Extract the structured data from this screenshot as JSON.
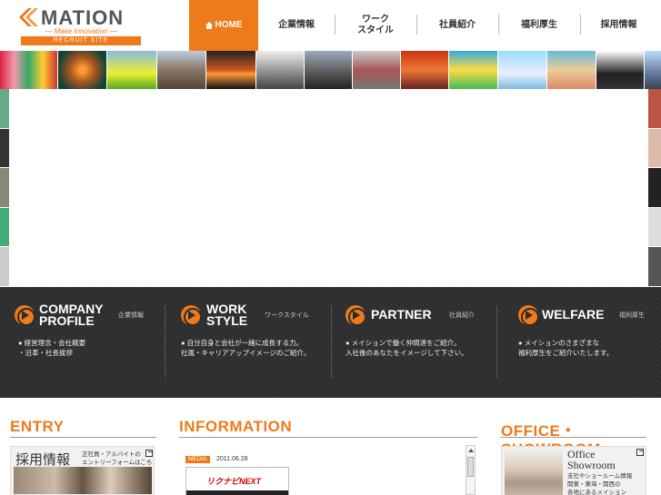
{
  "header": {
    "logo_word": "MATION",
    "logo_tagline": "― Make Innovation ―",
    "logo_site": "RECRUIT SITE",
    "brand_color": "#ef7a1a"
  },
  "nav": {
    "home": "HOME",
    "company": "企業情報",
    "workstyle": "ワーク\nスタイル",
    "staff": "社員紹介",
    "welfare": "福利厚生",
    "recruit": "採用情報"
  },
  "sections": {
    "company": {
      "title": "COMPANY\nPROFILE",
      "jp": "企業情報",
      "desc": "● 経営理念・会社概要\n・沿革・社長挨拶"
    },
    "work": {
      "title": "WORK\nSTYLE",
      "jp": "ワークスタイル",
      "desc": "● 自分自身と会社が一緒に成長する力。\n社風・キャリアアップイメージのご紹介。"
    },
    "partner": {
      "title": "PARTNER",
      "jp": "社員紹介",
      "desc": "● メイションで働く仲間達をご紹介。\n入社後のあなたをイメージして下さい。"
    },
    "welfare": {
      "title": "WELFARE",
      "jp": "福利厚生",
      "desc": "● メイションのさまざまな\n福利厚生をご紹介いたします。"
    }
  },
  "entry": {
    "heading": "ENTRY",
    "card_title": "採用情報",
    "card_text": "正社員・アルバイトの\nエントリーフォームはこちら"
  },
  "information": {
    "heading": "INFORMATION",
    "tag": "MEDIA",
    "date": "2011.06.28",
    "banner_text": "リクナビNEXT"
  },
  "office": {
    "heading": "OFFICE・SHOWROOM",
    "card_title": "Office\nShowroom",
    "card_text": "支社やショールーム情報\n関東・東海・関西の\n各地にあるメイション"
  }
}
